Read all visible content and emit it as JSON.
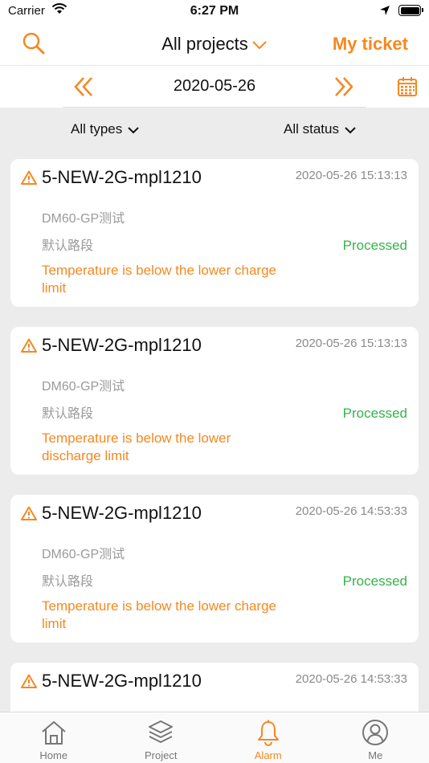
{
  "status_bar": {
    "carrier": "Carrier",
    "time": "6:27 PM"
  },
  "header": {
    "project_filter": "All projects",
    "my_ticket": "My ticket"
  },
  "date_bar": {
    "date": "2020-05-26"
  },
  "filters": {
    "types": "All types",
    "status": "All status"
  },
  "alarms": [
    {
      "device": "5-NEW-2G-mpl1210",
      "time": "2020-05-26 15:13:13",
      "model": "DM60-GP测试",
      "route": "默认路段",
      "status": "Processed",
      "message": "Temperature is below the lower charge limit"
    },
    {
      "device": "5-NEW-2G-mpl1210",
      "time": "2020-05-26 15:13:13",
      "model": "DM60-GP测试",
      "route": "默认路段",
      "status": "Processed",
      "message": "Temperature is below the lower discharge limit"
    },
    {
      "device": "5-NEW-2G-mpl1210",
      "time": "2020-05-26 14:53:33",
      "model": "DM60-GP测试",
      "route": "默认路段",
      "status": "Processed",
      "message": "Temperature is below the lower charge limit"
    },
    {
      "device": "5-NEW-2G-mpl1210",
      "time": "2020-05-26 14:53:33"
    }
  ],
  "tabs": [
    {
      "label": "Home",
      "icon": "home-icon"
    },
    {
      "label": "Project",
      "icon": "layers-icon"
    },
    {
      "label": "Alarm",
      "icon": "bell-icon"
    },
    {
      "label": "Me",
      "icon": "user-icon"
    }
  ],
  "colors": {
    "accent": "#f5881f",
    "processed": "#34b34a",
    "muted": "#9a9a9a"
  }
}
